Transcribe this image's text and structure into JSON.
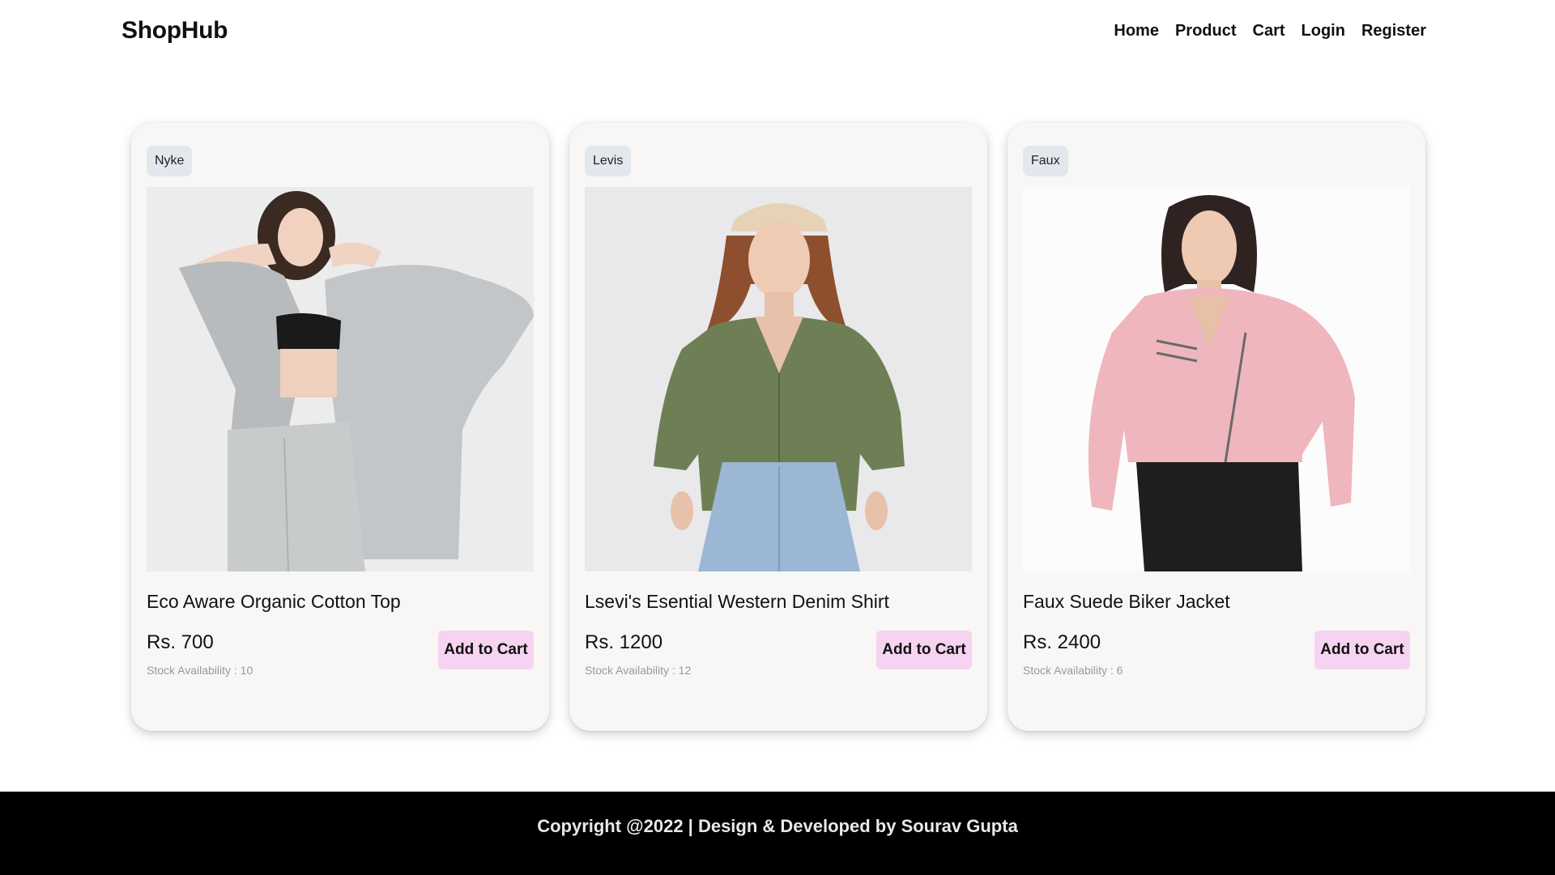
{
  "header": {
    "brand": "ShopHub",
    "nav": [
      "Home",
      "Product",
      "Cart",
      "Login",
      "Register"
    ]
  },
  "products": [
    {
      "brand": "Nyke",
      "title": "Eco Aware Organic Cotton Top",
      "price": "Rs. 700",
      "stock": "Stock Availability : 10",
      "button": "Add to Cart"
    },
    {
      "brand": "Levis",
      "title": "Lsevi's Esential Western Denim Shirt",
      "price": "Rs. 1200",
      "stock": "Stock Availability : 12",
      "button": "Add to Cart"
    },
    {
      "brand": "Faux",
      "title": "Faux Suede Biker Jacket",
      "price": "Rs. 2400",
      "stock": "Stock Availability : 6",
      "button": "Add to Cart"
    }
  ],
  "footer": {
    "text": "Copyright @2022 | Design & Developed by Sourav Gupta"
  }
}
